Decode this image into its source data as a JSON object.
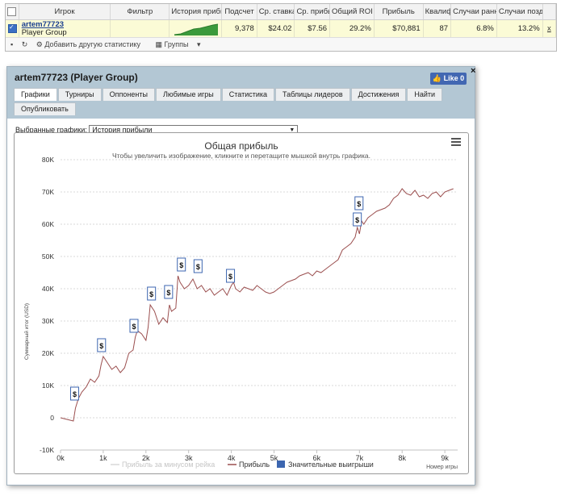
{
  "grid": {
    "headers": [
      "Игрок",
      "Фильтр",
      "История прибыли",
      "Подсчет",
      "Ср. ставка",
      "Ср. прибы",
      "Общий ROI",
      "Прибыль",
      "Квалиф",
      "Случаи ранн",
      "Случаи позд"
    ],
    "row": {
      "player_name": "artem77723",
      "player_group": "Player Group",
      "filter": "",
      "count": "9,378",
      "avg_bet": "$24.02",
      "avg_profit": "$7.56",
      "roi": "29.2%",
      "profit": "$70,881",
      "qualif": "87",
      "early": "6.8%",
      "late": "13.2%",
      "remove": "x"
    },
    "toolbar": {
      "add_stats": "Добавить другую статистику",
      "groups": "Группы"
    }
  },
  "panel": {
    "title": "artem77723 (Player Group)",
    "like": "Like 0",
    "close": "×",
    "tabs": [
      "Графики",
      "Турниры",
      "Оппоненты",
      "Любимые игры",
      "Статистика",
      "Таблицы лидеров",
      "Достижения",
      "Найти"
    ],
    "tabs_row2": [
      "Опубликовать"
    ],
    "selector_label": "Выбранные графики:",
    "selector_value": "История прибыли"
  },
  "chart_data": {
    "type": "line",
    "title": "Общая прибыль",
    "subtitle": "Чтобы увеличить изображение, кликните и перетащите мышкой внутрь графика.",
    "xlabel": "Номер игры",
    "ylabel": "Суммарный итог (USD)",
    "xlim": [
      0,
      9300
    ],
    "ylim": [
      -10000,
      80000
    ],
    "x_ticks": [
      "0k",
      "1k",
      "2k",
      "3k",
      "4k",
      "5k",
      "6k",
      "7k",
      "8k",
      "9k"
    ],
    "y_ticks": [
      "-10K",
      "0",
      "10K",
      "20K",
      "30K",
      "40K",
      "50K",
      "60K",
      "70K",
      "80K"
    ],
    "legend": [
      "Прибыль за минусом рейка",
      "Прибыль",
      "Значительные выигрыши"
    ],
    "series": [
      {
        "name": "Прибыль",
        "color": "#9b4f4f",
        "x": [
          0,
          150,
          300,
          350,
          420,
          500,
          600,
          700,
          800,
          900,
          950,
          1000,
          1100,
          1200,
          1300,
          1400,
          1500,
          1600,
          1700,
          1750,
          1800,
          1900,
          2000,
          2050,
          2100,
          2200,
          2300,
          2400,
          2500,
          2550,
          2600,
          2700,
          2750,
          2800,
          2900,
          3000,
          3100,
          3200,
          3300,
          3400,
          3500,
          3600,
          3700,
          3800,
          3900,
          4000,
          4050,
          4100,
          4200,
          4300,
          4400,
          4500,
          4600,
          4700,
          4800,
          4900,
          5000,
          5100,
          5200,
          5300,
          5400,
          5500,
          5600,
          5700,
          5800,
          5900,
          6000,
          6100,
          6200,
          6300,
          6400,
          6500,
          6600,
          6700,
          6800,
          6900,
          6950,
          7000,
          7050,
          7100,
          7200,
          7300,
          7400,
          7500,
          7600,
          7700,
          7800,
          7900,
          8000,
          8100,
          8200,
          8300,
          8400,
          8500,
          8600,
          8700,
          8800,
          8900,
          9000,
          9100,
          9200
        ],
        "y": [
          0,
          -500,
          -1000,
          3000,
          6000,
          8000,
          9500,
          12000,
          11000,
          13000,
          16500,
          19000,
          17000,
          15000,
          16000,
          14000,
          15500,
          20000,
          21000,
          25000,
          27000,
          26000,
          24000,
          28000,
          35000,
          33000,
          29000,
          31000,
          29500,
          35000,
          33000,
          34000,
          44000,
          42000,
          40000,
          41000,
          43000,
          40000,
          41000,
          39000,
          40000,
          38000,
          39000,
          40000,
          38000,
          41000,
          42000,
          40000,
          39000,
          40500,
          40000,
          39500,
          41000,
          40000,
          39000,
          38500,
          39000,
          40000,
          41000,
          42000,
          42500,
          43000,
          44000,
          44500,
          45000,
          44000,
          45500,
          45000,
          46000,
          47000,
          48000,
          49000,
          52000,
          53000,
          54000,
          56000,
          59000,
          57000,
          61000,
          60000,
          62000,
          63000,
          64000,
          64500,
          65000,
          66000,
          68000,
          69000,
          71000,
          69500,
          69000,
          70500,
          68500,
          69000,
          68000,
          69500,
          70000,
          68500,
          70000,
          70500,
          71000
        ]
      }
    ],
    "big_wins": [
      {
        "x": 330,
        "y": 5500
      },
      {
        "x": 960,
        "y": 20500
      },
      {
        "x": 1720,
        "y": 26500
      },
      {
        "x": 2130,
        "y": 36500
      },
      {
        "x": 2530,
        "y": 37000
      },
      {
        "x": 2830,
        "y": 45500
      },
      {
        "x": 3220,
        "y": 45000
      },
      {
        "x": 3980,
        "y": 42000
      },
      {
        "x": 6950,
        "y": 59500
      },
      {
        "x": 6990,
        "y": 64500
      }
    ],
    "big_win_label": "$"
  }
}
